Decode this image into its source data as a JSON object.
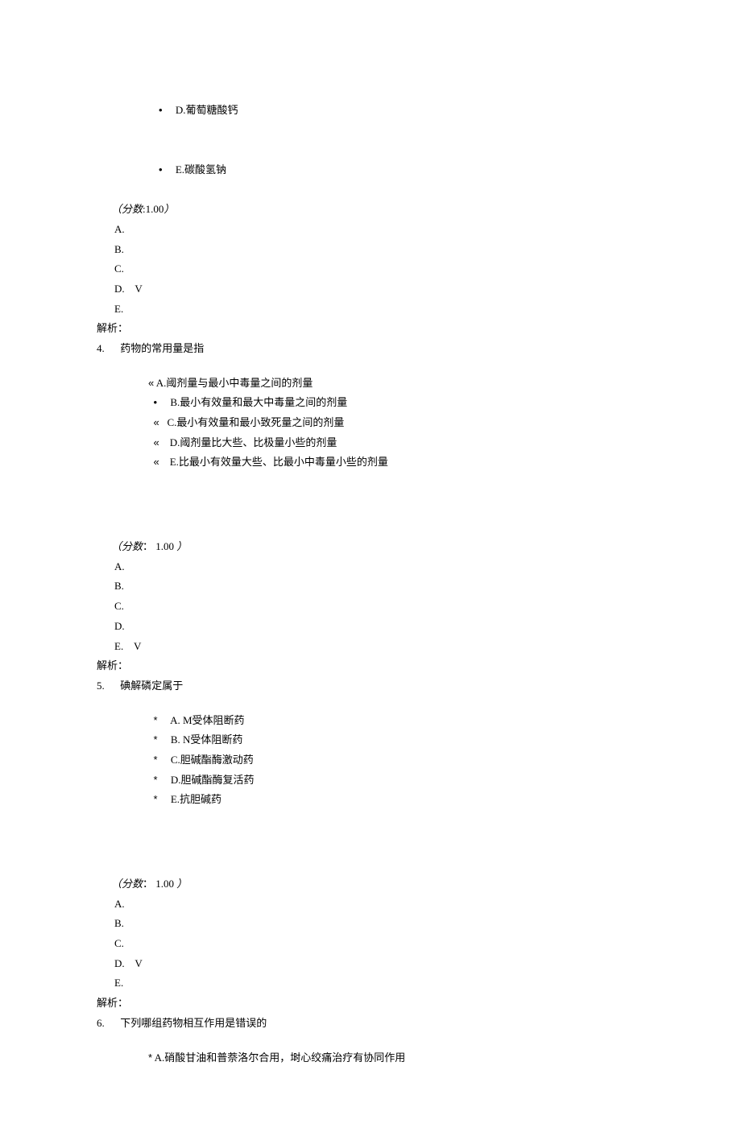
{
  "bullets": {
    "dot": "•",
    "quote": "«",
    "star": "*"
  },
  "labels": {
    "scorePrefix": "（分数",
    "scoreColon1": ":",
    "scoreColon2": "：",
    "scoreSuffix": "）",
    "explain": "解析：",
    "check": "V",
    "qSep": "."
  },
  "q3": {
    "optD": "D.葡萄糖酸钙",
    "optE": "E.碳酸氢钠",
    "score": "1.00",
    "ansA": "A.",
    "ansB": "B.",
    "ansC": "C.",
    "ansD": "D.",
    "ansE": "E."
  },
  "q4": {
    "num": "4",
    "stem": "药物的常用量是指",
    "optA": "A.阈剂量与最小中毒量之间的剂量",
    "optB": "B.最小有效量和最大中毒量之间的剂量",
    "optC": "C.最小有效量和最小致死量之间的剂量",
    "optD": "D.阈剂量比大些、比极量小些的剂量",
    "optE": "E.比最小有效量大些、比最小中毒量小些的剂量",
    "score": "1.00 ",
    "ansA": "A.",
    "ansB": "B.",
    "ansC": "C.",
    "ansD": "D.",
    "ansE": "E."
  },
  "q5": {
    "num": "5",
    "stem": "碘解磷定属于",
    "optA": "A. M受体阻断药",
    "optB": "B. N受体阻断药",
    "optC": "C.胆碱酯酶激动药",
    "optD": "D.胆碱酯酶复活药",
    "optE": "E.抗胆碱药",
    "score": "1.00 ",
    "ansA": "A.",
    "ansB": "B.",
    "ansC": "C.",
    "ansD": "D.",
    "ansE": "E."
  },
  "q6": {
    "num": "6",
    "stem": "下列哪组药物相互作用是错误的",
    "optA": "A.硝酸甘油和普萘洛尔合用，埘心绞痛治疗有协同作用"
  }
}
